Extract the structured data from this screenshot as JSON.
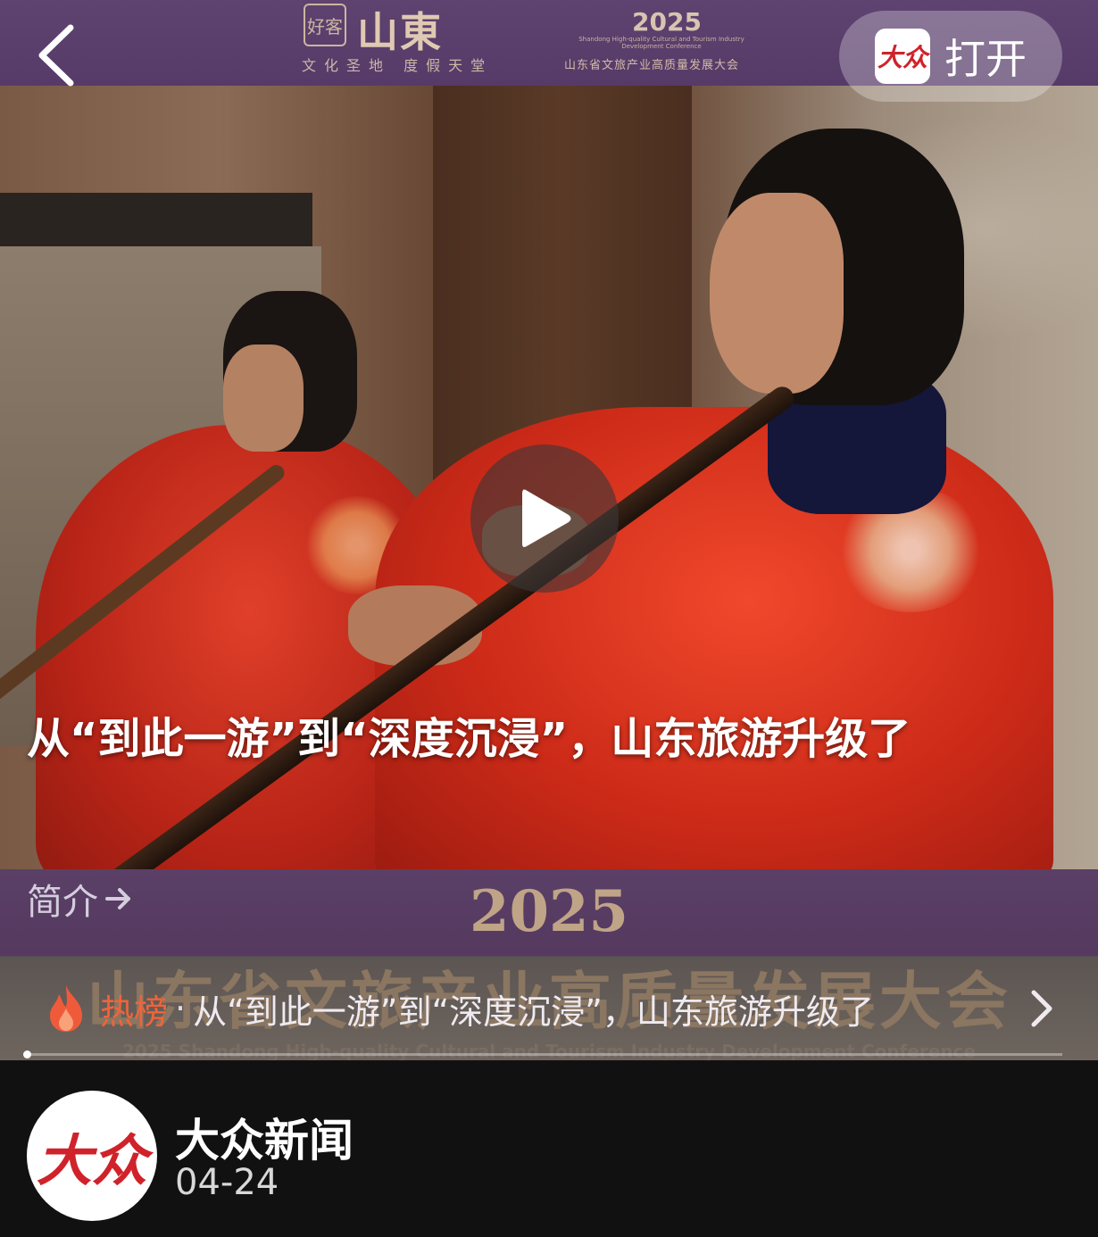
{
  "banner": {
    "seal_text": "好客",
    "brand": "山東",
    "motto": "文化圣地 度假天堂",
    "year": "2025",
    "conference_en": "Shandong High-quality Cultural and Tourism Industry Development Conference",
    "conference_cn": "山东省文旅产业高质量发展大会"
  },
  "header": {
    "back_icon": "chevron-left-icon",
    "open_button": {
      "logo_text": "大众",
      "label": "打开"
    }
  },
  "video": {
    "title": "从“到此一游”到“深度沉浸”，山东旅游升级了",
    "play_icon": "play-icon",
    "intro_label": "简介",
    "intro_icon": "arrow-right-icon",
    "overlay_year": "2025",
    "overlay_conference_cn": "山东省文旅产业高质量发展大会",
    "overlay_conference_en": "2025 Shandong High-quality Cultural and Tourism Industry Development Conference",
    "progress": 0.0
  },
  "hot": {
    "icon": "flame-icon",
    "label": "热榜",
    "separator": "·",
    "text": "从“到此一游”到“深度沉浸”，山东旅游升级了",
    "chevron_icon": "chevron-right-icon",
    "accent_color": "#f0643a"
  },
  "publisher": {
    "avatar_text": "大众",
    "name": "大众新闻",
    "date": "04-24"
  }
}
